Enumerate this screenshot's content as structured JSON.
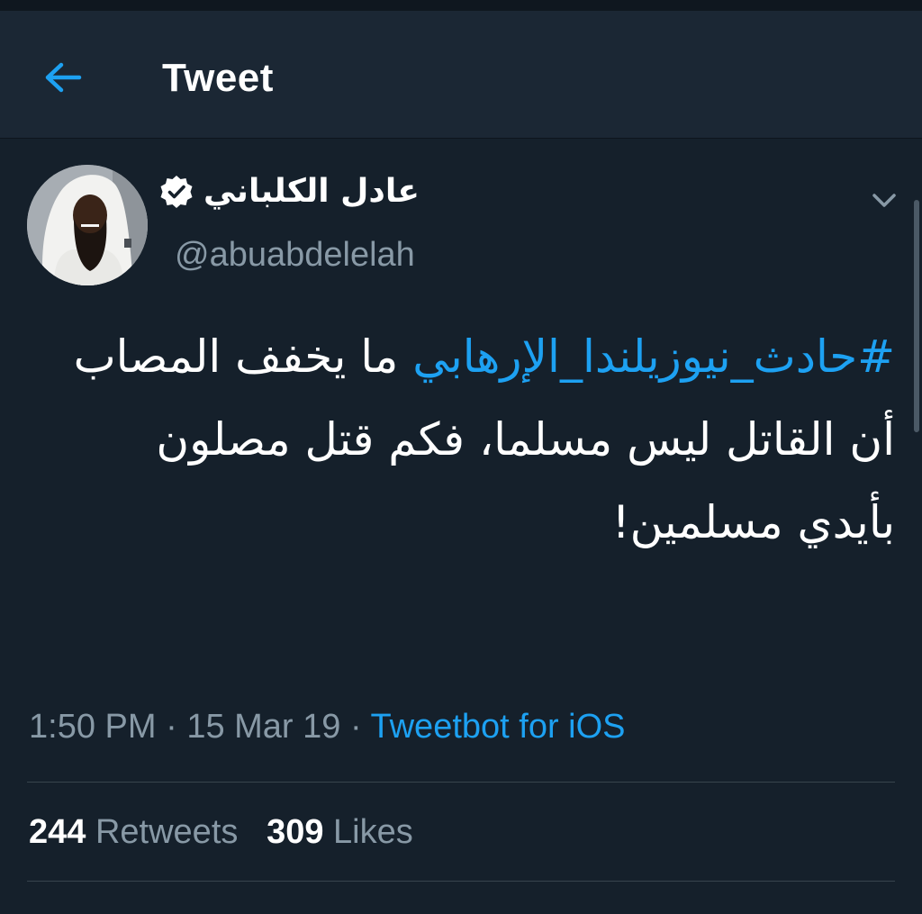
{
  "header": {
    "title": "Tweet",
    "back_icon": "arrow-left-icon"
  },
  "tweet": {
    "author": {
      "display_name": "عادل الكلباني",
      "handle": "@abuabdelelah",
      "verified": true
    },
    "text": {
      "hashtag": "#حادث_نيوزيلندا_الإرهابي",
      "body": " ما يخفف المصاب أن القاتل ليس مسلما، فكم قتل مصلون بأيدي مسلمين!"
    },
    "meta": {
      "time": "1:50 PM",
      "separator_1": " · ",
      "date": "15 Mar 19",
      "separator_2": " · ",
      "source": "Tweetbot for iOS"
    },
    "stats": {
      "retweets_count": "244",
      "retweets_label": "Retweets",
      "likes_count": "309",
      "likes_label": "Likes"
    }
  },
  "colors": {
    "background": "#15202b",
    "header_background": "#1b2734",
    "accent": "#1da1f2",
    "secondary_text": "#8899a6",
    "divider": "#38444d"
  }
}
